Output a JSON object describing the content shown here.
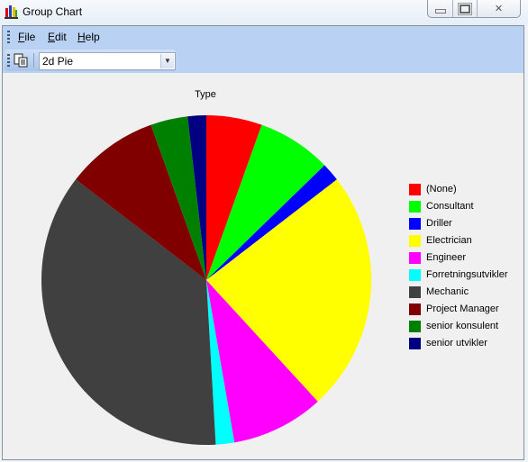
{
  "window": {
    "title": "Group Chart",
    "controls": [
      "minimize",
      "maximize",
      "close"
    ]
  },
  "menu": {
    "items": [
      "File",
      "Edit",
      "Help"
    ]
  },
  "toolbar": {
    "copy_icon": "copy-icon",
    "chart_type_selected": "2d Pie"
  },
  "chart_data": {
    "type": "pie",
    "title": "Type",
    "legend_position": "right",
    "start_angle": "top, clockwise",
    "categories": [
      "(None)",
      "Consultant",
      "Driller",
      "Electrician",
      "Engineer",
      "Forretningsutvikler",
      "Mechanic",
      "Project Manager",
      "senior konsulent",
      "senior utvikler"
    ],
    "values": [
      3,
      4,
      1,
      13,
      5,
      1,
      20,
      5,
      2,
      1
    ],
    "colors": [
      "#ff0000",
      "#00ff00",
      "#0000ff",
      "#ffff00",
      "#ff00ff",
      "#00ffff",
      "#404040",
      "#800000",
      "#008000",
      "#000080"
    ]
  }
}
